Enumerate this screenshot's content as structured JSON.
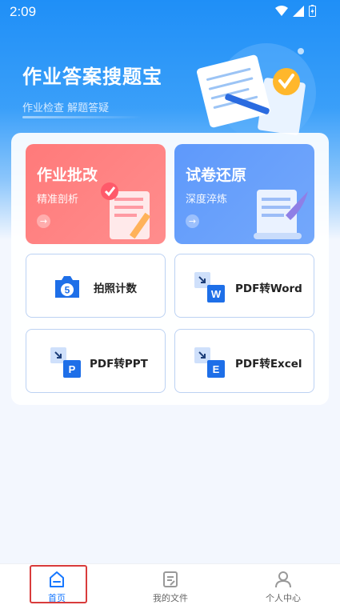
{
  "status": {
    "time": "2:09"
  },
  "header": {
    "title": "作业答案搜题宝",
    "subtitle": "作业检查 解题答疑"
  },
  "features": [
    {
      "title": "作业批改",
      "subtitle": "精准剖析"
    },
    {
      "title": "试卷还原",
      "subtitle": "深度淬炼"
    }
  ],
  "tools": [
    {
      "label": "拍照计数",
      "badge": "5"
    },
    {
      "label": "PDF转Word",
      "badge": "W"
    },
    {
      "label": "PDF转PPT",
      "badge": "P"
    },
    {
      "label": "PDF转Excel",
      "badge": "E"
    }
  ],
  "tabs": [
    {
      "label": "首页"
    },
    {
      "label": "我的文件"
    },
    {
      "label": "个人中心"
    }
  ],
  "colors": {
    "primary": "#1677ff",
    "red_card": "#ff7a7a",
    "blue_card": "#5e99fb"
  }
}
